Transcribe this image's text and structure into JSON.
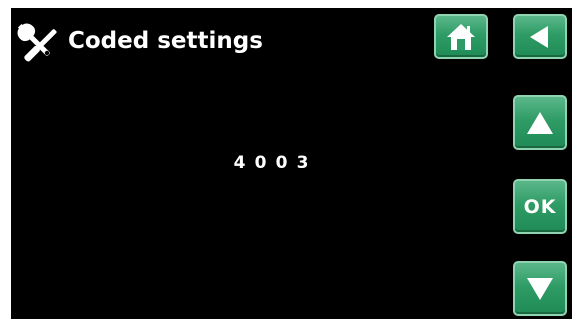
{
  "header": {
    "title": "Coded settings",
    "icon": "tools-icon"
  },
  "code": {
    "digits": [
      "4",
      "0",
      "0",
      "3"
    ]
  },
  "buttons": {
    "home_icon": "home-icon",
    "back_icon": "back-arrow-icon",
    "up_icon": "up-arrow-icon",
    "ok_label": "OK",
    "down_icon": "down-arrow-icon"
  },
  "colors": {
    "background": "#000000",
    "text": "#ffffff",
    "button_green": "#2f9c66",
    "button_border": "#8fd3b0"
  }
}
